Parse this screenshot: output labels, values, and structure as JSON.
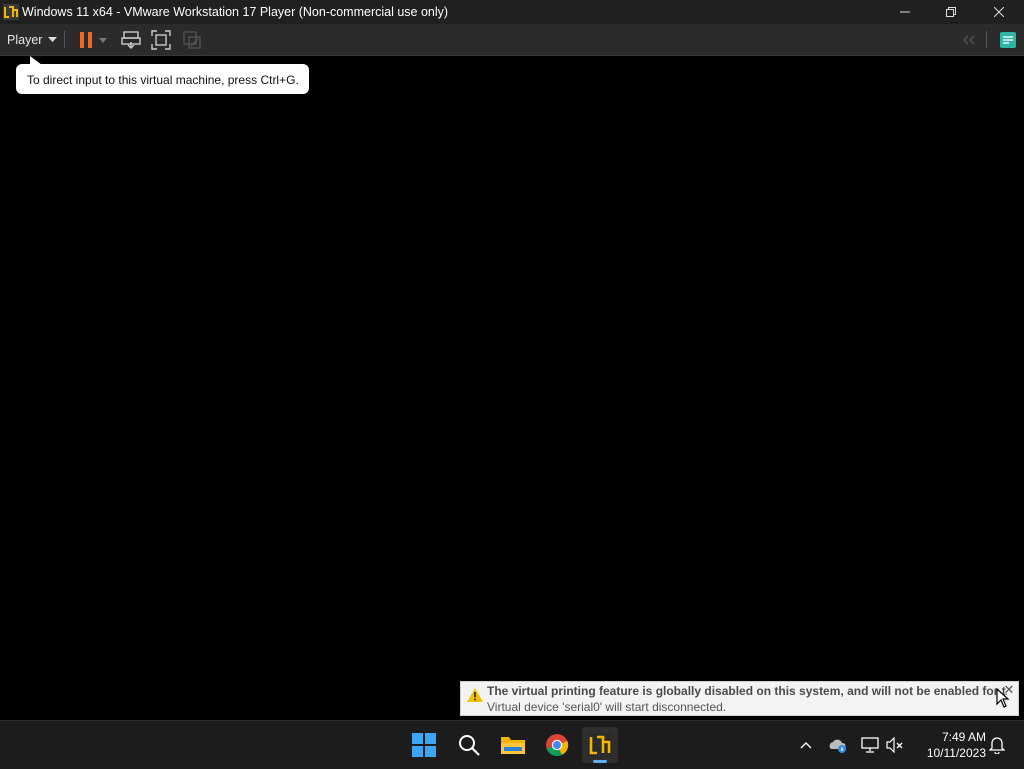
{
  "window": {
    "title": "Windows 11 x64 - VMware Workstation 17 Player (Non-commercial use only)",
    "controls": [
      "minimize",
      "restore",
      "close"
    ]
  },
  "toolbar": {
    "player_menu_label": "Player",
    "icons": [
      "pause-icon",
      "dropdown-icon",
      "send-ctrl-alt-del-icon",
      "full-screen-icon",
      "unity-icon",
      "back-icon",
      "library-icon"
    ],
    "accent_color": "#f06a24",
    "library_color": "#2fb5a8"
  },
  "tooltip": {
    "text": "To direct input to this virtual machine, press Ctrl+G."
  },
  "notification": {
    "title": "The virtual printing feature is globally disabled on this system, and will not be enabled for t...",
    "message": "Virtual device 'serial0' will start disconnected.",
    "close_label": "✕"
  },
  "taskbar": {
    "apps": [
      "start-icon",
      "search-icon",
      "file-explorer-icon",
      "chrome-icon",
      "vmware-icon"
    ],
    "tray": [
      "chevron-up-icon",
      "onedrive-icon",
      "network-icon",
      "volume-icon",
      "notifications-icon"
    ],
    "time": "7:49 AM",
    "date": "10/11/2023"
  }
}
